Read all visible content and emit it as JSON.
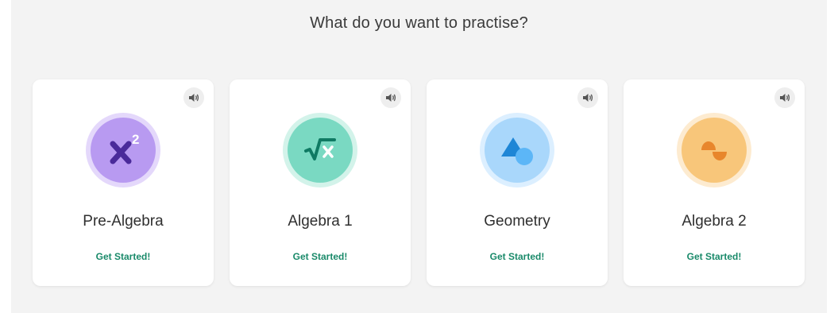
{
  "page": {
    "heading": "What do you want to practise?"
  },
  "cards": [
    {
      "title": "Pre-Algebra",
      "link": "Get Started!",
      "icon": "x-squared-icon",
      "ring": "#e4d8fb",
      "fill": "#b89af1",
      "glyph": "#4a2a9a"
    },
    {
      "title": "Algebra 1",
      "link": "Get Started!",
      "icon": "square-root-icon",
      "ring": "#d3f3ea",
      "fill": "#7ad9c2",
      "glyph": "#0f7a63"
    },
    {
      "title": "Geometry",
      "link": "Get Started!",
      "icon": "shapes-icon",
      "ring": "#dcefff",
      "fill": "#a9d7fb",
      "glyph": "#1e86d6"
    },
    {
      "title": "Algebra 2",
      "link": "Get Started!",
      "icon": "sine-wave-icon",
      "ring": "#fdebd0",
      "fill": "#f8c67a",
      "glyph": "#e8862c"
    }
  ],
  "colors": {
    "background": "#f3f3f3",
    "link": "#1a8a6a"
  },
  "icons": {
    "sound": "speaker-icon"
  }
}
